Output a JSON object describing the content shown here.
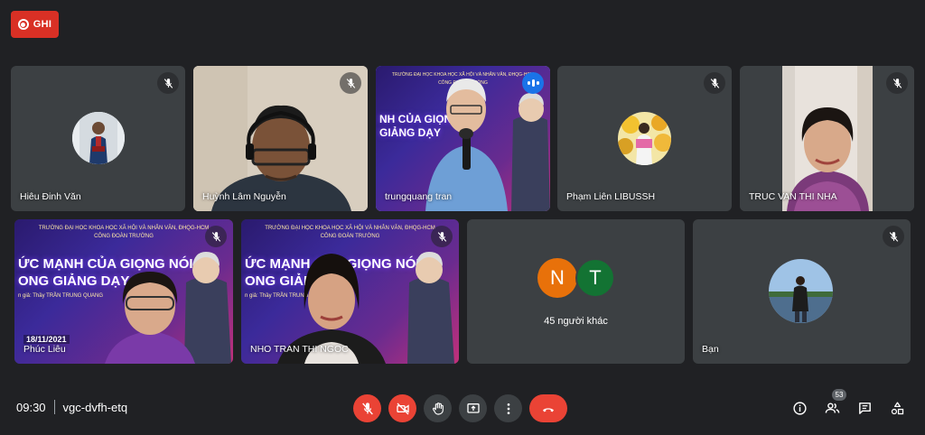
{
  "recording": {
    "label": "GHI",
    "color": "#d93025"
  },
  "participants": [
    {
      "name": "Hiêu Đinh Văn",
      "muted": true
    },
    {
      "name": "Huỳnh Lâm Nguyễn",
      "muted": true
    },
    {
      "name": "trungquang tran",
      "muted": false,
      "speaking": true
    },
    {
      "name": "Phạm Liên LIBUSSH",
      "muted": true
    },
    {
      "name": "TRUC VAN THI NHA",
      "muted": true
    },
    {
      "name": "Phúc Liêu",
      "muted": true
    },
    {
      "name": "NHO TRAN THI NGOC",
      "muted": true
    },
    {
      "name": "Bạn",
      "muted": true
    }
  ],
  "others": {
    "label": "45 người khác",
    "avatars": [
      {
        "letter": "N",
        "color": "#e8710a"
      },
      {
        "letter": "T",
        "color": "#137333"
      }
    ]
  },
  "stage": {
    "title_line1": "ỨC MẠNH CỦA GIỌNG NÓI",
    "title_line2": "ONG GIẢNG DẠY",
    "center_title_line1": "NH CỦA GIỌNG NÓ",
    "center_title_line2": "GIẢNG DẠY",
    "speaker": "n giả: Thầy TRẦN TRUNG QUANG",
    "date": "18/11/2021"
  },
  "meeting": {
    "time": "09:30",
    "code": "vgc-dvfh-etq",
    "participant_count": "53"
  },
  "controls": {
    "mic": "mic-off-icon",
    "camera": "videocam-off-icon",
    "raise_hand": "hand-icon",
    "present": "present-icon",
    "more": "more-vert-icon",
    "leave": "call-end-icon"
  },
  "accent": {
    "red": "#ea4335",
    "blue": "#1a73e8",
    "tile": "#3c4043",
    "bg": "#202124"
  }
}
